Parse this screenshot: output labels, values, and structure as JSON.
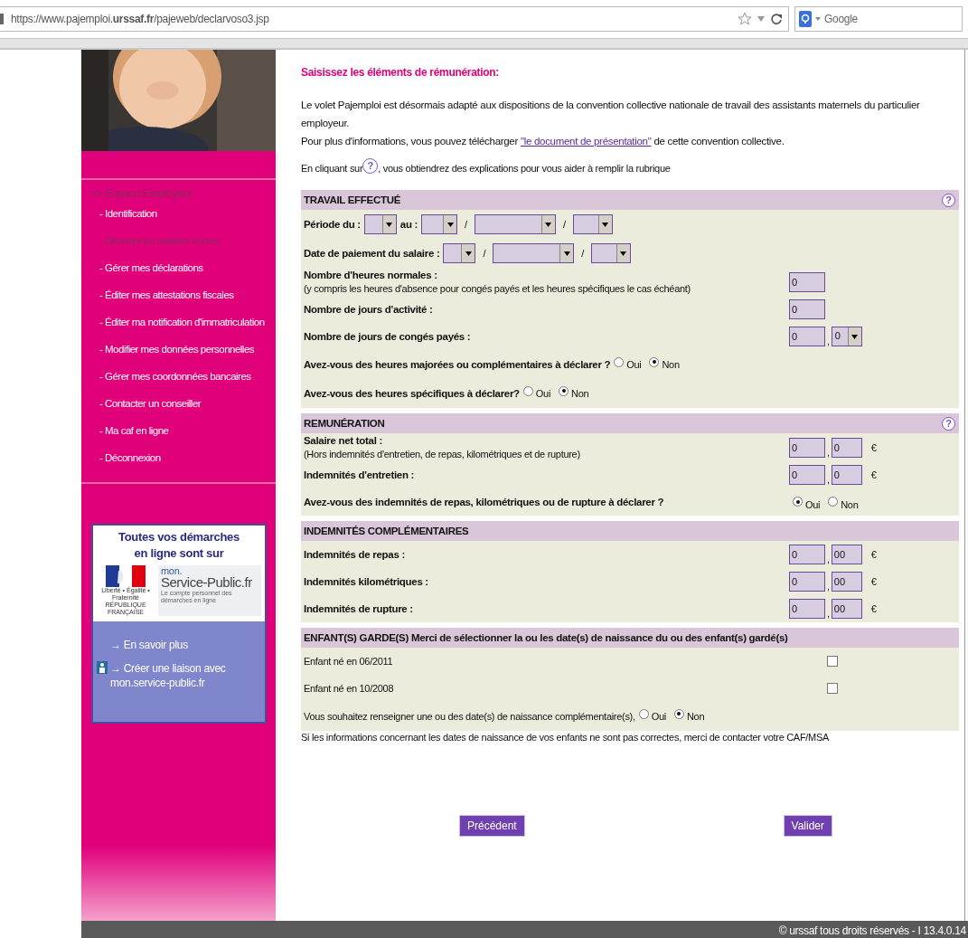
{
  "browser": {
    "url": "https://www.pajemploi.**urssaf.fr**/pajeweb/declarvoso3.jsp",
    "search_placeholder": "Google"
  },
  "sidebar": {
    "heading": ">> Espace Employeur",
    "items": [
      {
        "label": "- Identification",
        "current": false
      },
      {
        "label": "- Déclarer les salaires versés",
        "current": true
      },
      {
        "label": "- Gérer mes déclarations",
        "current": false
      },
      {
        "label": "- Éditer mes attestations fiscales",
        "current": false
      },
      {
        "label": "- Éditer ma notification d'immatriculation",
        "current": false
      },
      {
        "label": "- Modifier mes données personnelles",
        "current": false
      },
      {
        "label": "- Gérer mes coordonnées bancaires",
        "current": false
      },
      {
        "label": "- Contacter un conseiller",
        "current": false
      },
      {
        "label": "- Ma caf en ligne",
        "current": false
      },
      {
        "label": "- Déconnexion",
        "current": false
      }
    ],
    "promo": {
      "title": "Toutes vos **démarches** **en ligne** sont sur",
      "republic_motto": "Liberté • Égalité • Fraternité",
      "republic_name": "RÉPUBLIQUE FRANÇAISE",
      "brand_top": "mon.",
      "brand_name": "Service-Public.fr",
      "brand_tagline": "Le compte personnel des démarches en ligne",
      "links": [
        {
          "text": "→ En savoir plus",
          "icon": false
        },
        {
          "text": "→ Créer une liaison avec mon.service-public.fr",
          "icon": true
        }
      ]
    }
  },
  "main": {
    "title": "Saisissez les éléments de rémunération:",
    "intro_line1": "Le volet Pajemploi est désormais adapté aux dispositions de la convention collective nationale de travail des assistants maternels du particulier employeur.",
    "intro_before": "Pour plus d'informations, vous pouvez télécharger ",
    "intro_link": "\"le document de présentation\"",
    "intro_after": " de cette convention collective.",
    "help_before": "En cliquant sur ",
    "help_symbol": "?",
    "help_after": ", vous obtiendrez des explications pour vous aider à remplir la rubrique",
    "sections": [
      {
        "title": "TRAVAIL EFFECTUÉ",
        "help": "?",
        "rows": [
          {
            "kind": "dates",
            "parts": [
              {
                "kind": "label",
                "text": "Période du :"
              },
              {
                "kind": "select"
              },
              {
                "kind": "label",
                "text": "au :"
              },
              {
                "kind": "select"
              },
              {
                "kind": "sep",
                "text": "/"
              },
              {
                "kind": "select"
              },
              {
                "kind": "sep",
                "text": "/"
              },
              {
                "kind": "select"
              }
            ]
          },
          {
            "kind": "dates",
            "parts": [
              {
                "kind": "label",
                "text": "Date de paiement du salaire :"
              },
              {
                "kind": "select"
              },
              {
                "kind": "sep",
                "text": "/"
              },
              {
                "kind": "select"
              },
              {
                "kind": "sep",
                "text": "/"
              },
              {
                "kind": "select"
              }
            ]
          },
          {
            "kind": "amount",
            "label": "Nombre d'heures normales :",
            "note": "(y compris les heures d'absence pour congés payés et les heures spécifiques le cas échéant)",
            "fields": [
              {
                "kind": "input",
                "value": "0"
              }
            ]
          },
          {
            "kind": "amount",
            "label": "Nombre de jours d'activité :",
            "fields": [
              {
                "kind": "input",
                "value": "0"
              }
            ]
          },
          {
            "kind": "amount",
            "label": "Nombre de jours de congés payés :",
            "fields": [
              {
                "kind": "input",
                "value": "0"
              },
              {
                "kind": "select",
                "value": "0"
              }
            ],
            "separator": ","
          },
          {
            "kind": "radio",
            "label": "Avez-vous des heures majorées ou complémentaires à déclarer ?",
            "options": [
              {
                "label": "Oui",
                "selected": false
              },
              {
                "label": "Non",
                "selected": true
              }
            ]
          },
          {
            "kind": "radio",
            "label": "Avez-vous des heures spécifiques à déclarer?",
            "options": [
              {
                "label": "Oui",
                "selected": false
              },
              {
                "label": "Non",
                "selected": true
              }
            ]
          }
        ]
      },
      {
        "title": "REMUNÉRATION",
        "help": "?",
        "rows": [
          {
            "kind": "amount",
            "label": "Salaire net total :",
            "note": "(Hors indemnités d'entretien, de repas, kilométriques et de rupture)",
            "fields": [
              {
                "kind": "input",
                "value": "0"
              },
              {
                "kind": "input",
                "value": "0"
              }
            ],
            "separator": ",",
            "unit": "€"
          },
          {
            "kind": "amount",
            "label": "Indemnités d'entretien :",
            "fields": [
              {
                "kind": "input",
                "value": "0"
              },
              {
                "kind": "input",
                "value": "0"
              }
            ],
            "separator": ",",
            "unit": "€"
          },
          {
            "kind": "radio-column",
            "label": "Avez-vous des indemnités de repas, kilométriques ou de rupture à déclarer ?",
            "options": [
              {
                "label": "Oui",
                "selected": true
              },
              {
                "label": "Non",
                "selected": false
              }
            ]
          }
        ]
      },
      {
        "title": "INDEMNITÉS COMPLÉMENTAIRES",
        "rows": [
          {
            "kind": "amount",
            "label": "Indemnités de repas :",
            "fields": [
              {
                "kind": "input",
                "value": "0"
              },
              {
                "kind": "input",
                "value": "00"
              }
            ],
            "separator": ",",
            "unit": "€"
          },
          {
            "kind": "amount",
            "label": "Indemnités kilométriques :",
            "fields": [
              {
                "kind": "input",
                "value": "0"
              },
              {
                "kind": "input",
                "value": "00"
              }
            ],
            "separator": ",",
            "unit": "€"
          },
          {
            "kind": "amount",
            "label": "Indemnités de rupture :",
            "fields": [
              {
                "kind": "input",
                "value": "0"
              },
              {
                "kind": "input",
                "value": "00"
              }
            ],
            "separator": ",",
            "unit": "€"
          }
        ]
      },
      {
        "title": "ENFANT(S) GARDE(S) Merci de sélectionner la ou les date(s) de naissance du ou des enfant(s) gardé(s)",
        "rows": [
          {
            "kind": "checkbox",
            "label": "Enfant né en 06/2011",
            "checked": false
          },
          {
            "kind": "checkbox",
            "label": "Enfant né en 10/2008",
            "checked": false
          },
          {
            "kind": "radio-plain",
            "label": "Vous souhaitez renseigner une ou des date(s) de naissance complémentaire(s),",
            "options": [
              {
                "label": "Oui",
                "selected": false
              },
              {
                "label": "Non",
                "selected": true
              }
            ]
          }
        ]
      }
    ],
    "notice": "Si les informations concernant les dates de naissance de vos enfants ne sont pas correctes, merci de contacter votre CAF/MSA",
    "buttons": [
      {
        "label": "Précédent"
      },
      {
        "label": "Valider"
      }
    ]
  },
  "footer": "© urssaf tous droits réservés - I 13.4.0.14"
}
